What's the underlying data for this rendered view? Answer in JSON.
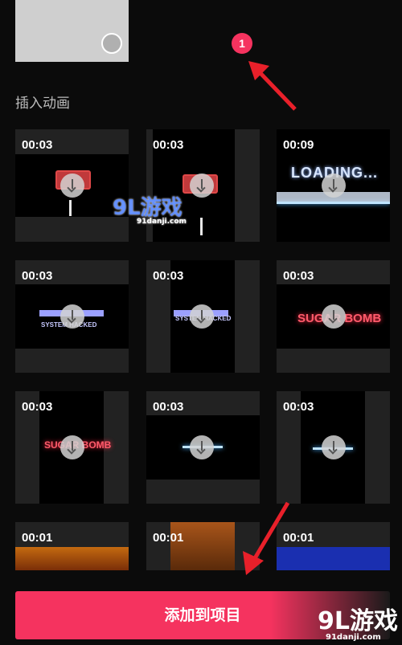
{
  "badge": {
    "count": "1"
  },
  "section": {
    "title": "插入动画"
  },
  "tiles": [
    {
      "duration": "00:03"
    },
    {
      "duration": "00:03"
    },
    {
      "duration": "00:09",
      "art_text": "LOADING..."
    },
    {
      "duration": "00:03",
      "art_text": "SYSTEM HACKED"
    },
    {
      "duration": "00:03",
      "art_text": "SYSTEM HACKED"
    },
    {
      "duration": "00:03",
      "art_text": "SUGAR BOMB"
    },
    {
      "duration": "00:03",
      "art_text": "SUGAR BOMB"
    },
    {
      "duration": "00:03"
    },
    {
      "duration": "00:03"
    },
    {
      "duration": "00:01"
    },
    {
      "duration": "00:01"
    },
    {
      "duration": "00:01"
    }
  ],
  "cta": {
    "label": "添加到项目"
  },
  "watermark": {
    "brand": "9L游戏",
    "domain": "91danji.com"
  },
  "colors": {
    "accent": "#f5335f",
    "background": "#0b0b0b",
    "tile": "#222222"
  }
}
